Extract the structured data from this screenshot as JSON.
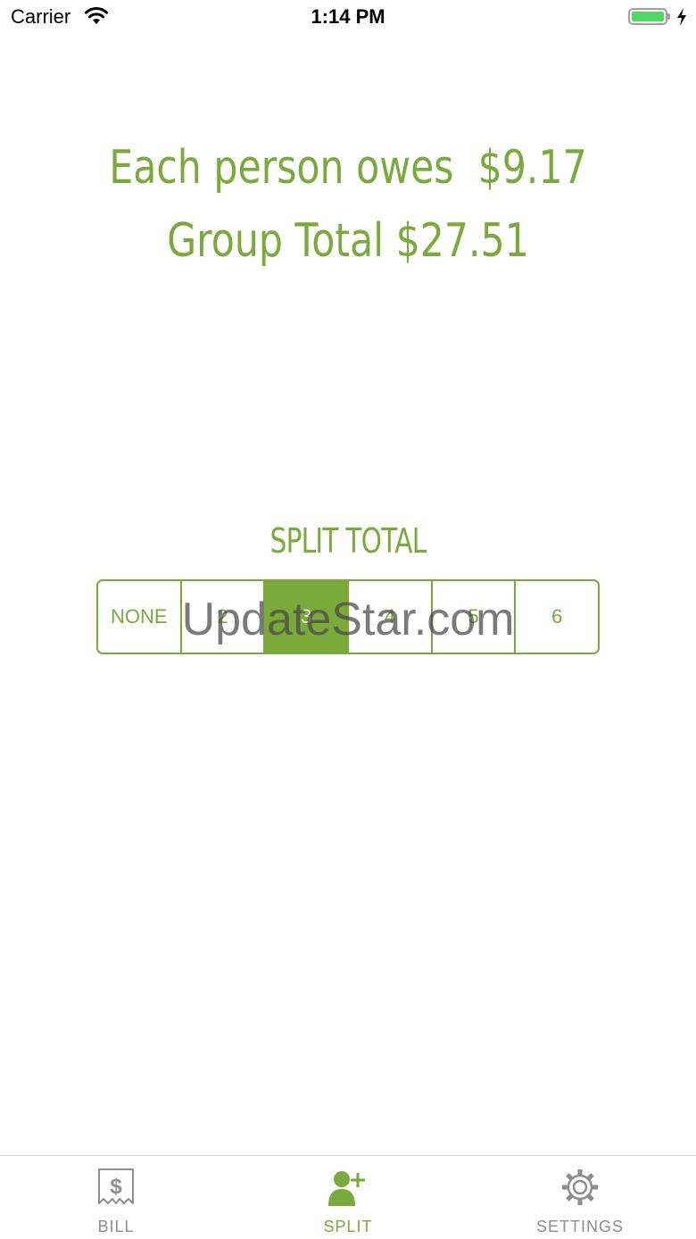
{
  "status_bar": {
    "carrier": "Carrier",
    "time": "1:14 PM"
  },
  "summary": {
    "owes_label": "Each person owes",
    "owes_value": "$9.17",
    "total_label": "Group Total",
    "total_value": "$27.51"
  },
  "split": {
    "heading": "SPLIT TOTAL",
    "options": [
      "NONE",
      "2",
      "3",
      "4",
      "5",
      "6"
    ],
    "selected": "3"
  },
  "watermark": "UpdateStar.com",
  "tab_bar": {
    "tabs": [
      {
        "label": "BILL",
        "icon": "bill-icon",
        "active": false
      },
      {
        "label": "SPLIT",
        "icon": "add-person-icon",
        "active": true
      },
      {
        "label": "SETTINGS",
        "icon": "gear-icon",
        "active": false
      }
    ]
  },
  "colors": {
    "accent": "#7aab3a",
    "inactive": "#8e8e8e",
    "battery": "#4cd964"
  }
}
